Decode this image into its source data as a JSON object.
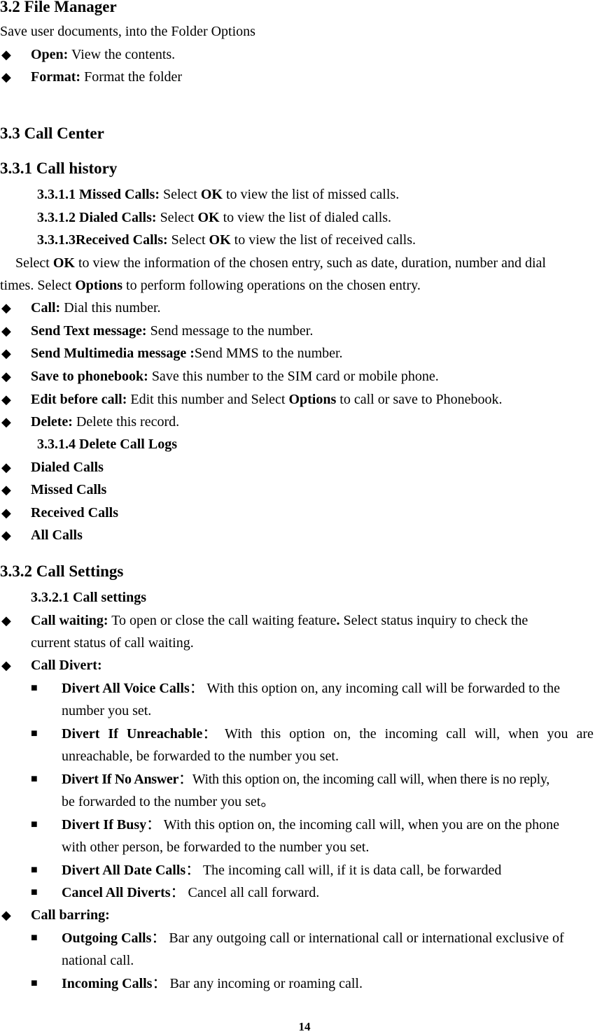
{
  "sections": {
    "file_manager": {
      "title": "3.2 File Manager",
      "intro": "Save user documents, into the Folder Options",
      "items": [
        {
          "label": "Open:",
          "text": " View the contents."
        },
        {
          "label": "Format:",
          "text": " Format the folder"
        }
      ]
    },
    "call_center": {
      "title": "3.3 Call Center",
      "call_history": {
        "title": "3.3.1 Call history",
        "subitems": [
          {
            "label": "3.3.1.1 Missed Calls:",
            "pre": " Select ",
            "ok": "OK",
            "post": " to view the list of missed calls."
          },
          {
            "label": "3.3.1.2 Dialed Calls:",
            "pre": " Select ",
            "ok": "OK",
            "post": " to view the list of dialed calls."
          },
          {
            "label": "3.3.1.3Received Calls:",
            "pre": " Select ",
            "ok": "OK",
            "post": " to view the list of received calls."
          }
        ],
        "paragraph": {
          "l1_pre": "Select ",
          "l1_ok": "OK",
          "l1_post": " to view the information of the chosen entry, such as date, duration, number and dial",
          "l2_pre": "times. Select ",
          "l2_options": "Options",
          "l2_post": " to perform following operations on the chosen entry."
        },
        "options": [
          {
            "label": "Call:",
            "text": " Dial this number."
          },
          {
            "label": "Send Text message:",
            "text": " Send message to the number."
          },
          {
            "label": "Send Multimedia message :",
            "text": "Send MMS to the number."
          },
          {
            "label": "Save to phonebook:",
            "text": " Save this number to the SIM card or mobile phone."
          },
          {
            "label": "Edit before call:",
            "text": " Edit this number and Select ",
            "bold2": "Options",
            "text2": " to call or save to Phonebook."
          },
          {
            "label": "Delete:",
            "text": " Delete this record."
          }
        ],
        "delete_logs": {
          "title": "3.3.1.4 Delete Call Logs",
          "items": [
            "Dialed Calls",
            "Missed Calls",
            "Received Calls",
            "All Calls"
          ]
        }
      },
      "call_settings": {
        "title": "3.3.2 Call Settings",
        "subtitle": "3.3.2.1 Call settings",
        "call_waiting": {
          "label": "Call waiting:",
          "text_l1": " To open or close the call waiting feature",
          "dot": ".",
          "text_l1b": " Select status inquiry to check the",
          "text_l2": "current status of call waiting."
        },
        "call_divert": {
          "label": "Call Divert:",
          "items": [
            {
              "label": "Divert All Voice Calls",
              "sep": "：",
              "l1": " With this option on, any incoming call will be forwarded to the",
              "l2": "number you set."
            },
            {
              "label": "Divert If Unreachable",
              "sep": "：",
              "l1": " With this option on, the incoming call will, when you are",
              "l2": "unreachable, be forwarded to the number you set."
            },
            {
              "label": "Divert If No Answer",
              "sep": "：",
              "l1": "With this option on, the incoming call will, when there is no reply,",
              "l2": "be forwarded to the number you set。"
            },
            {
              "label": "Divert If Busy",
              "sep": "：",
              "l1": " With this option on, the incoming call will, when you are on the phone",
              "l2": "with other person, be forwarded to the number you set."
            },
            {
              "label": "Divert All Date Calls",
              "sep": "：",
              "l1": " The incoming call will, if it is data call, be forwarded",
              "l2": ""
            },
            {
              "label": "Cancel All Diverts",
              "sep": "：",
              "l1": " Cancel all call forward.",
              "l2": ""
            }
          ]
        },
        "call_barring": {
          "label": "Call barring:",
          "items": [
            {
              "label": "Outgoing Calls",
              "sep": "：",
              "l1": " Bar any outgoing call or international call or international exclusive of",
              "l2": "national call."
            },
            {
              "label": "Incoming Calls",
              "sep": "：",
              "l1": " Bar any incoming or roaming call.",
              "l2": ""
            }
          ]
        }
      }
    }
  },
  "bullets": {
    "diamond": "◆",
    "square": "■"
  },
  "page_number": "14"
}
